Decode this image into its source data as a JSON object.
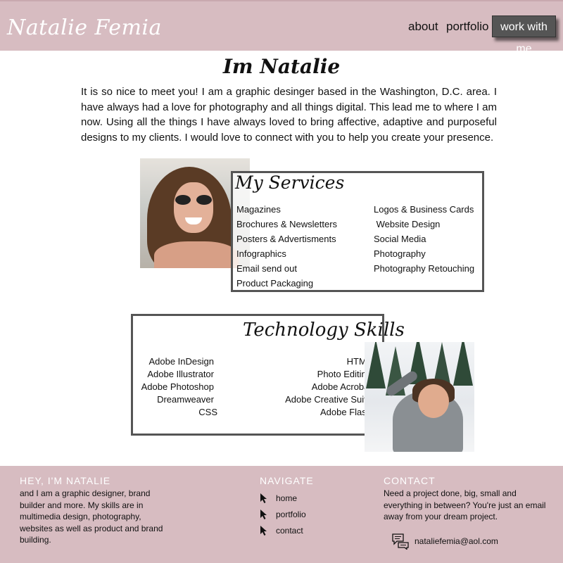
{
  "header": {
    "logo": "Natalie Femia",
    "nav": {
      "about": "about",
      "portfolio": "portfolio",
      "work_with_me": "work with me"
    }
  },
  "intro": {
    "title": "Im Natalie",
    "text": "It is so nice to meet you! I am  a graphic desinger based in the Washington, D.C. area. I have always had a love for photography and all things digital. This lead me to where I am now. Using all the things I have always loved to bring affective, adaptive and purposeful designs to my clients. I would love to connect with you to help you create your presence."
  },
  "services": {
    "title": "My Services",
    "left": [
      "Magazines",
      "Brochures & Newsletters",
      "Posters & Advertisments",
      "Infographics",
      "Email send out",
      "Product Packaging"
    ],
    "right": [
      "Logos & Business Cards",
      " Website Design",
      "Social Media",
      "Photography",
      "Photography Retouching"
    ]
  },
  "tech": {
    "title": "Technology Skills",
    "left": [
      "Adobe InDesign",
      "Adobe Illustrator",
      "Adobe Photoshop",
      "Dreamweaver",
      "CSS"
    ],
    "right": [
      "HTML",
      "Photo Editing",
      "Adobe Acrobat",
      "Adobe Creative Suite",
      "Adobe Flash"
    ]
  },
  "footer": {
    "about": {
      "heading": "HEY, I'M NATALIE",
      "text": "and I am a graphic designer, brand builder and more. My skills are in multimedia design, photography, websites as well as product and brand building."
    },
    "navigate": {
      "heading": "NAVIGATE",
      "links": [
        "home",
        "portfolio",
        "contact"
      ]
    },
    "contact": {
      "heading": "CONTACT",
      "text": "Need a project done, big, small and everything in between? You're just an email away from your dream project.",
      "email": "nataliefemia@aol.com"
    }
  },
  "colors": {
    "header_bg": "#d7bcc1",
    "footer_bg": "#d7bcc1",
    "button_bg": "#555555"
  },
  "icons": {
    "nav_cursor": "cursor-arrow-icon",
    "email": "chat-bubble-icon"
  }
}
